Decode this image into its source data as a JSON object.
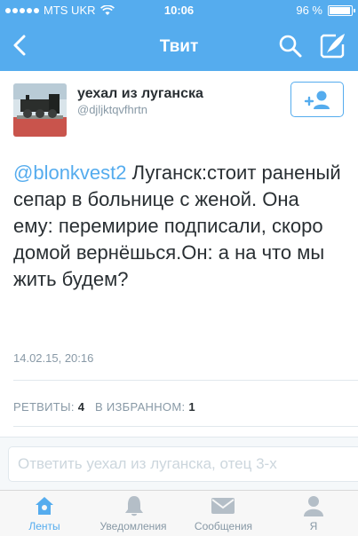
{
  "status_bar": {
    "carrier": "MTS UKR",
    "time": "10:06",
    "battery": "96 %",
    "battery_level": 0.96
  },
  "nav": {
    "title": "Твит",
    "icons": [
      "chevron-left-icon",
      "search-icon",
      "compose-icon"
    ]
  },
  "author": {
    "name": "уехал из луганска",
    "handle": "@djljktqvfhrtn",
    "follow_icon": "add-user-icon"
  },
  "tweet": {
    "mention": "@blonkvest2",
    "text": " Луганск:стоит раненый сепар в больнице с женой. Она ему: перемирие подписали, скоро домой вернёшься.Он: а на что мы жить будем?",
    "date": "14.02.15, 20:16"
  },
  "stats": {
    "retweets_label": "РЕТВИТЫ:",
    "retweets_count": "4",
    "favorites_label": "В ИЗБРАННОМ:",
    "favorites_count": "1"
  },
  "reply": {
    "placeholder": "Ответить уехал из луганска, отец 3-х"
  },
  "tabs": [
    {
      "label": "Ленты",
      "icon": "home-icon",
      "active": true
    },
    {
      "label": "Уведомления",
      "icon": "bell-icon",
      "active": false
    },
    {
      "label": "Сообщения",
      "icon": "envelope-icon",
      "active": false
    },
    {
      "label": "Я",
      "icon": "person-icon",
      "active": false
    }
  ],
  "colors": {
    "accent": "#55acee",
    "text": "#292f33",
    "muted": "#8899a6"
  }
}
